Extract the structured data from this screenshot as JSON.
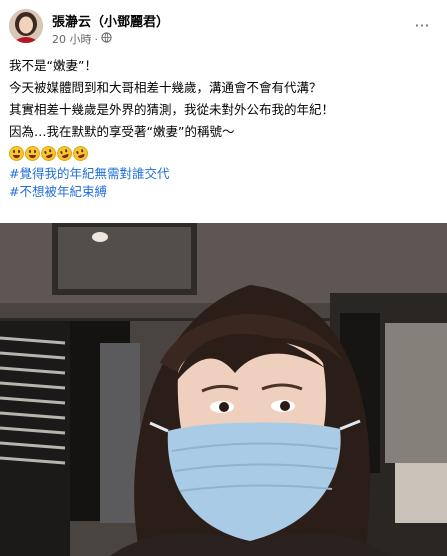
{
  "post": {
    "author": "張瀞云（小鄧麗君）",
    "time": "20 小時",
    "separator": "·",
    "privacy_icon": "globe-icon",
    "more_icon": "more-options-icon",
    "more_label": "···"
  },
  "text": {
    "line1": "我不是“嫩妻”！",
    "line2": "今天被媒體問到和大哥相差十幾歲，溝通會不會有代溝？",
    "line3": "其實相差十幾歲是外界的猜測，我從未對外公布我的年紀！",
    "line4": "因為…我在默默的享受著“嫩妻”的稱號～",
    "emojis": [
      "grinning-squinting-face",
      "grinning-squinting-face",
      "rolling-on-floor-laughing",
      "rolling-on-floor-laughing",
      "rolling-on-floor-laughing"
    ]
  },
  "hashtags": {
    "tag1": "#覺得我的年紀無需對誰交代",
    "tag2": "#不想被年紀束縛"
  },
  "colors": {
    "hashtag": "#216fdb",
    "mask": "#a9cbe6"
  }
}
